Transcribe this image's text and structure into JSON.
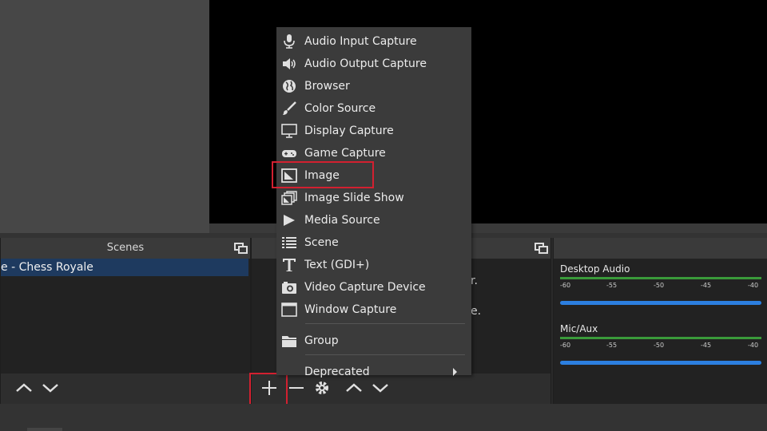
{
  "scenes": {
    "title": "Scenes",
    "items": [
      "e - Chess Royale"
    ]
  },
  "sources": {
    "partial_text_1": "r.",
    "partial_text_2": "e."
  },
  "mixer": {
    "channels": [
      {
        "name": "Desktop Audio",
        "scale": [
          "-60",
          "-55",
          "-50",
          "-45",
          "-40"
        ]
      },
      {
        "name": "Mic/Aux",
        "scale": [
          "-60",
          "-55",
          "-50",
          "-45",
          "-40"
        ]
      }
    ]
  },
  "menu": {
    "items": [
      {
        "label": "Audio Input Capture",
        "icon": "microphone-icon"
      },
      {
        "label": "Audio Output Capture",
        "icon": "speaker-icon"
      },
      {
        "label": "Browser",
        "icon": "globe-icon"
      },
      {
        "label": "Color Source",
        "icon": "brush-icon"
      },
      {
        "label": "Display Capture",
        "icon": "monitor-icon"
      },
      {
        "label": "Game Capture",
        "icon": "gamepad-icon"
      },
      {
        "label": "Image",
        "icon": "image-icon"
      },
      {
        "label": "Image Slide Show",
        "icon": "slideshow-icon"
      },
      {
        "label": "Media Source",
        "icon": "play-icon"
      },
      {
        "label": "Scene",
        "icon": "list-icon"
      },
      {
        "label": "Text (GDI+)",
        "icon": "text-icon"
      },
      {
        "label": "Video Capture Device",
        "icon": "camera-icon"
      },
      {
        "label": "Window Capture",
        "icon": "window-icon"
      },
      {
        "label": "Group",
        "icon": "folder-icon"
      },
      {
        "label": "Deprecated",
        "icon": ""
      }
    ]
  },
  "colors": {
    "highlight": "#d22030",
    "selection": "#1e3a5f",
    "meter_green": "#3a9a3a",
    "meter_blue": "#2c7fe0"
  }
}
